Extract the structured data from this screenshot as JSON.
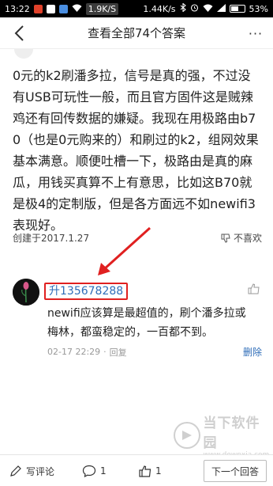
{
  "status_bar": {
    "time": "13:22",
    "speed_left": "1.9K/S",
    "speed_right": "1.44K/s",
    "battery": "53%"
  },
  "header": {
    "title": "查看全部74个答案",
    "more": "···"
  },
  "answer": {
    "lines": [
      "0元的k2刷潘多拉，信号是真的强，不过没",
      "有USB可玩性一般，而且官方固件这是贼辣",
      "鸡还有回传数据的嫌疑。我现在用极路由b7",
      "0（也是0元购来的）和刷过的k2，组网效果",
      "基本满意。顺便吐槽一下，极路由是真的麻",
      "瓜，用钱买真算不上有意思，比如这B70就",
      "是极4的定制版，但是各方面远不如newifi3",
      "表现好。"
    ],
    "created": "创建于2017.1.27",
    "dislike_label": "不喜欢"
  },
  "comment": {
    "username": "升135678288",
    "lines": [
      "newifi应该算是最超值的，刷个潘多拉或",
      "梅林，都蛮稳定的，一百都不到。"
    ],
    "time": "02-17 22:29",
    "separator": "·",
    "reply_label": "回复",
    "delete_label": "删除"
  },
  "watermark": {
    "name": "当下软件园",
    "url": "www.downxia.com"
  },
  "bottom_bar": {
    "write_label": "写评论",
    "comment_count": "1",
    "like_count": "1",
    "next_label": "下一个回答"
  }
}
